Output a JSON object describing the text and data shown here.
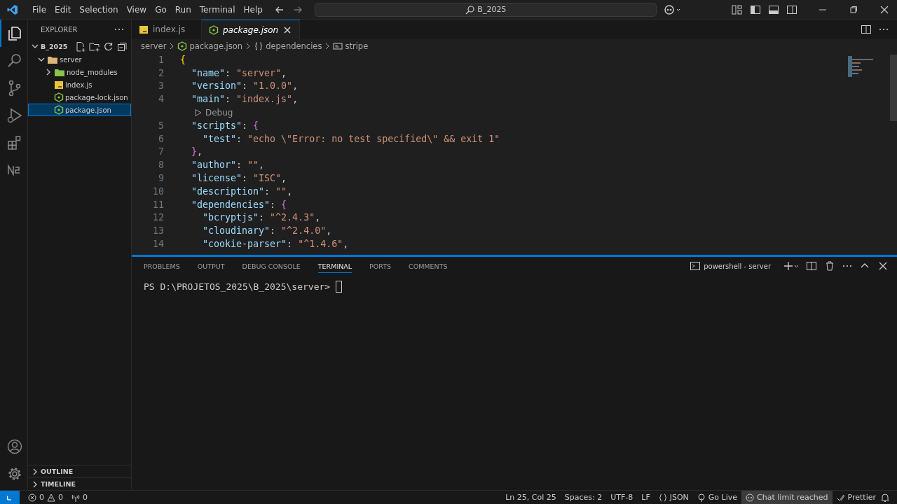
{
  "title_bar": {
    "menu": [
      "File",
      "Edit",
      "Selection",
      "View",
      "Go",
      "Run",
      "Terminal",
      "Help"
    ],
    "search": "B_2025"
  },
  "activity_bar": {
    "items": [
      {
        "kind": "files",
        "selected": true
      },
      {
        "kind": "search",
        "selected": false
      },
      {
        "kind": "source-control",
        "selected": false
      },
      {
        "kind": "run",
        "selected": false
      },
      {
        "kind": "extensions",
        "selected": false
      },
      {
        "kind": "extension-n",
        "selected": false
      }
    ]
  },
  "sidebar": {
    "title": "EXPLORER",
    "section": {
      "label": "B_2025",
      "expanded": true
    },
    "tree": [
      {
        "label": "server",
        "kind": "folder",
        "expanded": true,
        "selected": false,
        "children": [
          {
            "label": "node_modules",
            "kind": "folder",
            "expanded": false,
            "selected": false
          },
          {
            "label": "index.js",
            "kind": "js",
            "selected": false
          },
          {
            "label": "package-lock.json",
            "kind": "json",
            "selected": false
          },
          {
            "label": "package.json",
            "kind": "json",
            "selected": true
          }
        ]
      }
    ],
    "bottom_sections": [
      {
        "label": "OUTLINE",
        "expanded": false
      },
      {
        "label": "TIMELINE",
        "expanded": false
      }
    ]
  },
  "editor": {
    "tabs": [
      {
        "label": "index.js",
        "kind": "js",
        "selected": false,
        "preview": false
      },
      {
        "label": "package.json",
        "kind": "json",
        "selected": true,
        "preview": true
      }
    ],
    "breadcrumb": [
      {
        "label": "server",
        "kind": "folder"
      },
      {
        "label": "package.json",
        "kind": "json"
      },
      {
        "label": "dependencies",
        "kind": "object"
      },
      {
        "label": "stripe",
        "kind": "field"
      }
    ],
    "lines": [
      {
        "number": "1",
        "tokens": [
          {
            "kind": "brace1",
            "text": "{"
          }
        ]
      },
      {
        "number": "2",
        "tokens": [
          {
            "kind": "key",
            "text": "  \"name\""
          },
          {
            "kind": "punct",
            "text": ": "
          },
          {
            "kind": "str",
            "text": "\"server\""
          },
          {
            "kind": "punct",
            "text": ","
          }
        ]
      },
      {
        "number": "3",
        "tokens": [
          {
            "kind": "key",
            "text": "  \"version\""
          },
          {
            "kind": "punct",
            "text": ": "
          },
          {
            "kind": "str",
            "text": "\"1.0.0\""
          },
          {
            "kind": "punct",
            "text": ","
          }
        ]
      },
      {
        "number": "4",
        "tokens": [
          {
            "kind": "key",
            "text": "  \"main\""
          },
          {
            "kind": "punct",
            "text": ": "
          },
          {
            "kind": "str",
            "text": "\"index.js\""
          },
          {
            "kind": "punct",
            "text": ","
          }
        ]
      },
      {
        "kind": "codelens",
        "text": "Debug"
      },
      {
        "number": "5",
        "tokens": [
          {
            "kind": "key",
            "text": "  \"scripts\""
          },
          {
            "kind": "punct",
            "text": ": "
          },
          {
            "kind": "brace2",
            "text": "{"
          }
        ]
      },
      {
        "number": "6",
        "tokens": [
          {
            "kind": "key",
            "text": "    \"test\""
          },
          {
            "kind": "punct",
            "text": ": "
          },
          {
            "kind": "str",
            "text": "\"echo \\\"Error: no test specified\\\" && exit 1\""
          }
        ]
      },
      {
        "number": "7",
        "tokens": [
          {
            "kind": "brace2",
            "text": "  }"
          },
          {
            "kind": "punct",
            "text": ","
          }
        ]
      },
      {
        "number": "8",
        "tokens": [
          {
            "kind": "key",
            "text": "  \"author\""
          },
          {
            "kind": "punct",
            "text": ": "
          },
          {
            "kind": "str",
            "text": "\"\""
          },
          {
            "kind": "punct",
            "text": ","
          }
        ]
      },
      {
        "number": "9",
        "tokens": [
          {
            "kind": "key",
            "text": "  \"license\""
          },
          {
            "kind": "punct",
            "text": ": "
          },
          {
            "kind": "str",
            "text": "\"ISC\""
          },
          {
            "kind": "punct",
            "text": ","
          }
        ]
      },
      {
        "number": "10",
        "tokens": [
          {
            "kind": "key",
            "text": "  \"description\""
          },
          {
            "kind": "punct",
            "text": ": "
          },
          {
            "kind": "str",
            "text": "\"\""
          },
          {
            "kind": "punct",
            "text": ","
          }
        ]
      },
      {
        "number": "11",
        "tokens": [
          {
            "kind": "key",
            "text": "  \"dependencies\""
          },
          {
            "kind": "punct",
            "text": ": "
          },
          {
            "kind": "brace2",
            "text": "{"
          }
        ]
      },
      {
        "number": "12",
        "tokens": [
          {
            "kind": "key",
            "text": "    \"bcryptjs\""
          },
          {
            "kind": "punct",
            "text": ": "
          },
          {
            "kind": "str",
            "text": "\"^2.4.3\""
          },
          {
            "kind": "punct",
            "text": ","
          }
        ]
      },
      {
        "number": "13",
        "tokens": [
          {
            "kind": "key",
            "text": "    \"cloudinary\""
          },
          {
            "kind": "punct",
            "text": ": "
          },
          {
            "kind": "str",
            "text": "\"^2.4.0\""
          },
          {
            "kind": "punct",
            "text": ","
          }
        ]
      },
      {
        "number": "14",
        "tokens": [
          {
            "kind": "key",
            "text": "    \"cookie-parser\""
          },
          {
            "kind": "punct",
            "text": ": "
          },
          {
            "kind": "str",
            "text": "\"^1.4.6\""
          },
          {
            "kind": "punct",
            "text": ","
          }
        ]
      }
    ]
  },
  "panel": {
    "tabs": [
      {
        "label": "PROBLEMS",
        "selected": false
      },
      {
        "label": "OUTPUT",
        "selected": false
      },
      {
        "label": "DEBUG CONSOLE",
        "selected": false
      },
      {
        "label": "TERMINAL",
        "selected": true
      },
      {
        "label": "PORTS",
        "selected": false
      },
      {
        "label": "COMMENTS",
        "selected": false
      }
    ],
    "terminal_name": "powershell - server",
    "prompt": "PS D:\\PROJETOS_2025\\B_2025\\server> "
  },
  "status_bar": {
    "errors": "0",
    "warnings": "0",
    "ports": "0",
    "items": [
      {
        "kind": "text",
        "text": "Ln 25, Col 25"
      },
      {
        "kind": "text",
        "text": "Spaces: 2"
      },
      {
        "kind": "text",
        "text": "UTF-8"
      },
      {
        "kind": "text",
        "text": "LF"
      },
      {
        "kind": "language",
        "text": "JSON"
      },
      {
        "kind": "golive",
        "text": "Go Live"
      },
      {
        "kind": "chat",
        "text": "Chat limit reached"
      },
      {
        "kind": "prettier",
        "text": "Prettier"
      },
      {
        "kind": "bell"
      }
    ]
  }
}
